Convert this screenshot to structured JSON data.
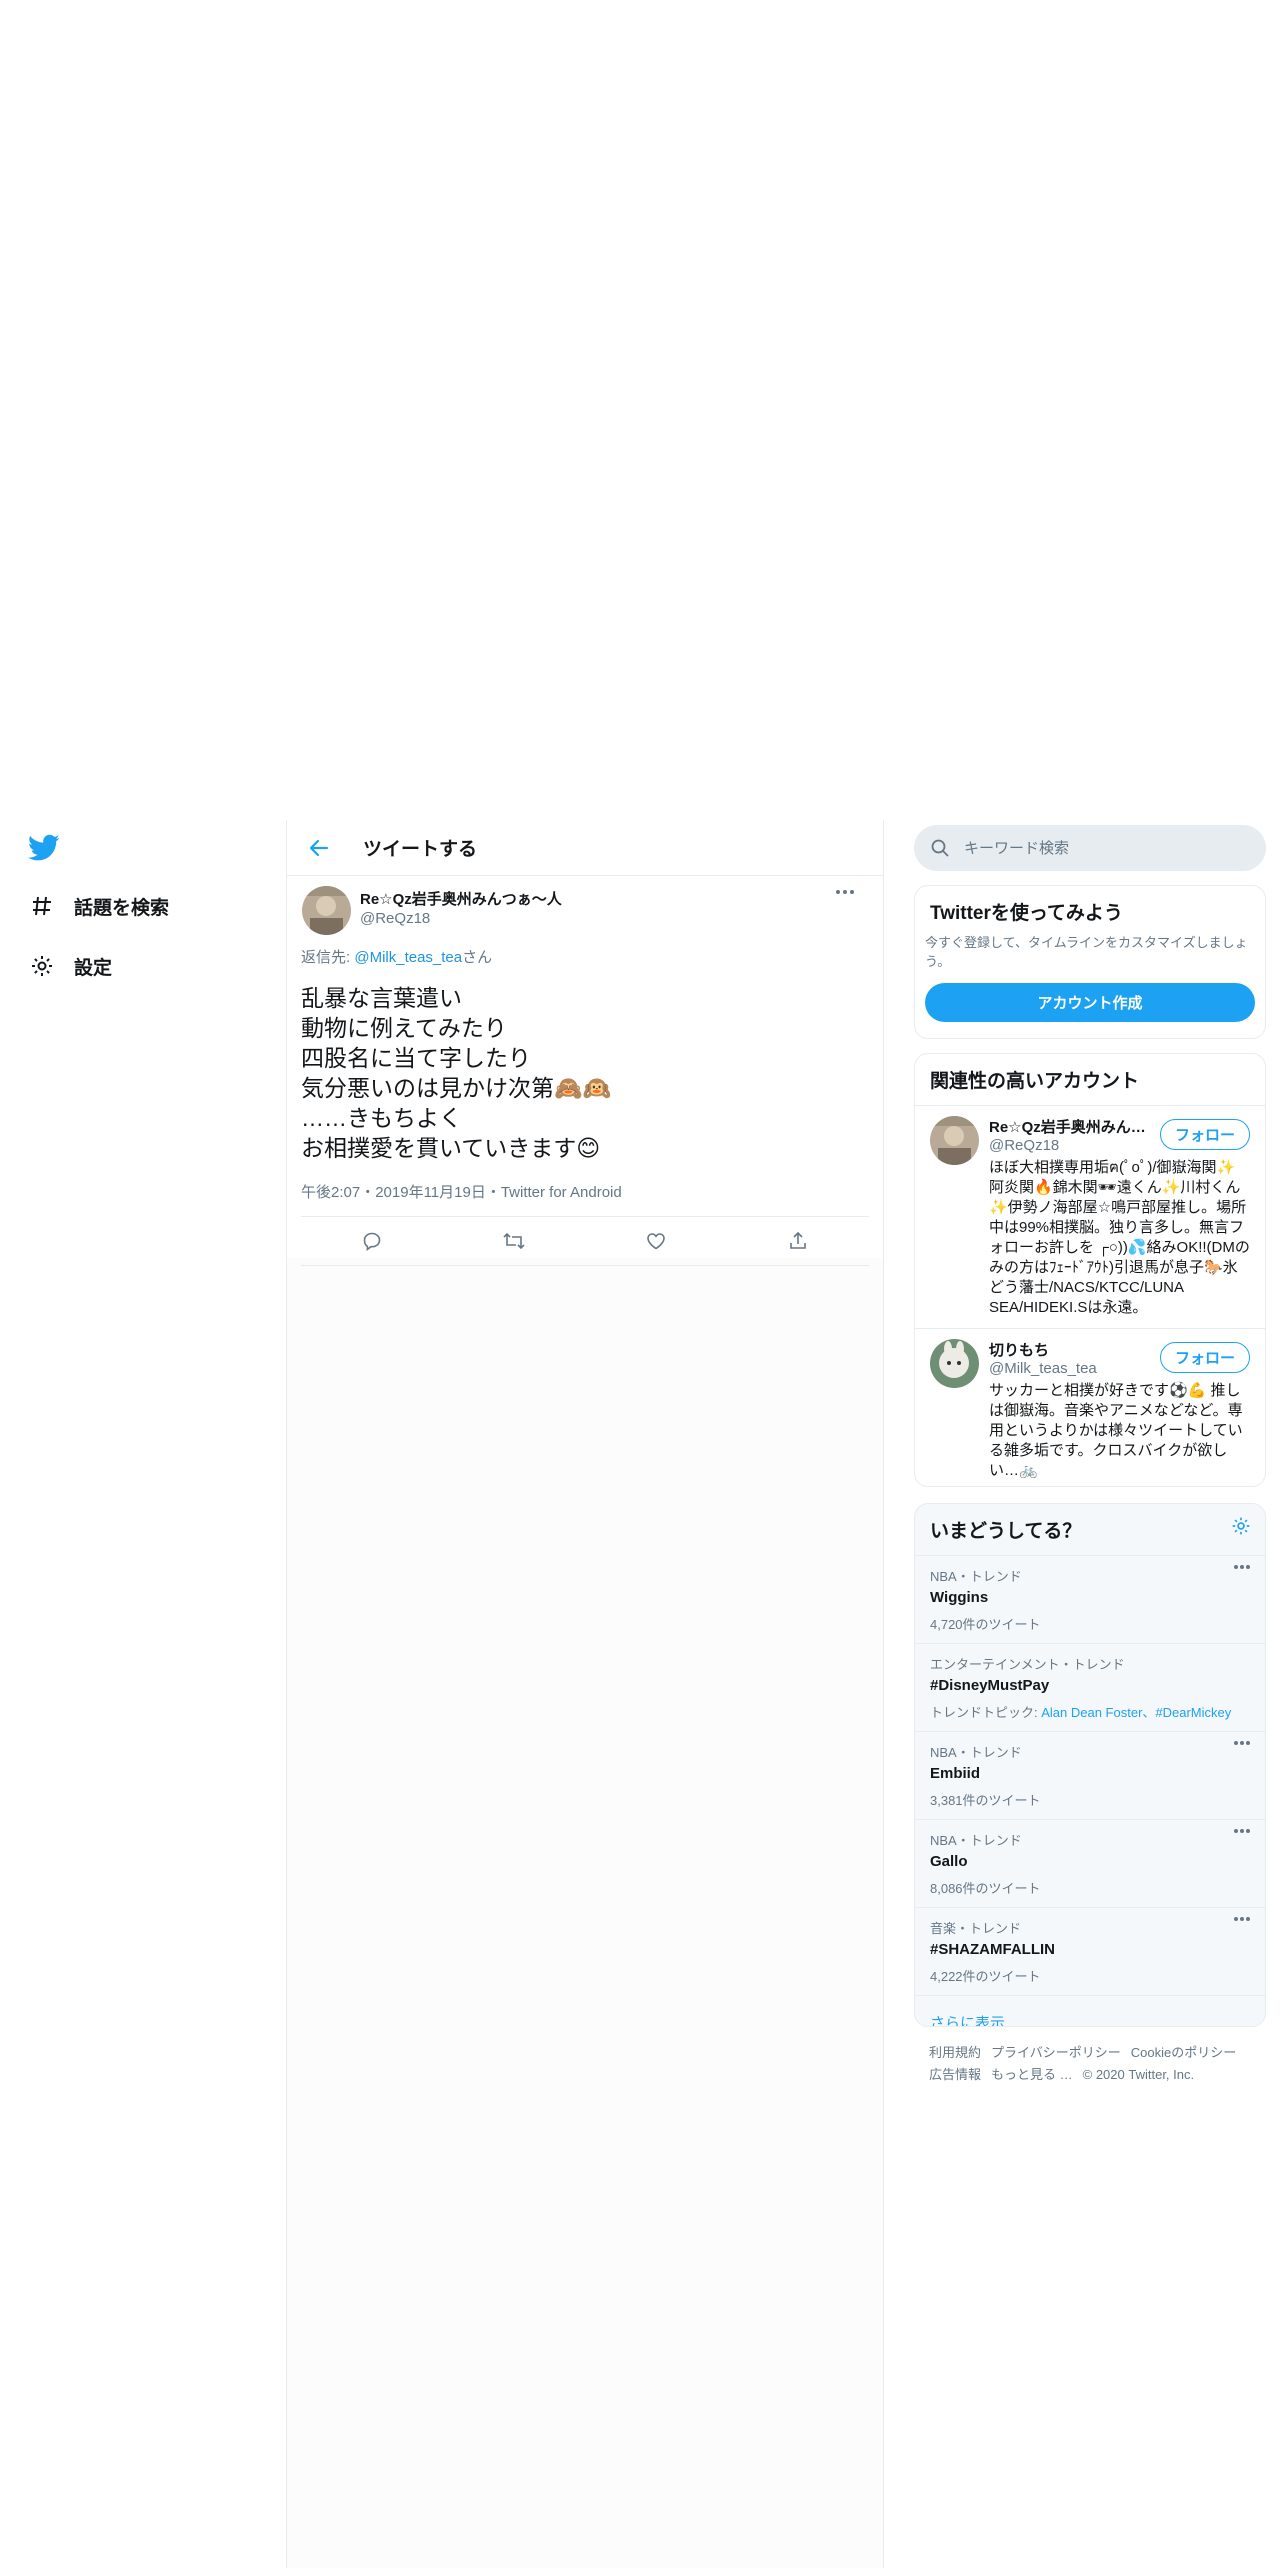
{
  "nav": {
    "logo": "twitter-bird",
    "explore": "話題を検索",
    "settings": "設定"
  },
  "header": {
    "title": "ツイートする"
  },
  "tweet": {
    "name": "Re☆Qz岩手奥州みんつぁ〜人",
    "handle": "@ReQz18",
    "reply_prefix": "返信先: ",
    "reply_handle": "@Milk_teas_tea",
    "reply_suffix": "さん",
    "text": "乱暴な言葉遣い\n動物に例えてみたり\n四股名に当て字したり\n気分悪いのは見かけ次第🙈🙉\n……きもちよく\nお相撲愛を貫いていきます😊",
    "meta": "午後2:07・2019年11月19日・Twitter for Android"
  },
  "search": {
    "placeholder": "キーワード検索"
  },
  "signup": {
    "title": "Twitterを使ってみよう",
    "subtitle": "今すぐ登録して、タイムラインをカスタマイズしましょう。",
    "button": "アカウント作成"
  },
  "related": {
    "title": "関連性の高いアカウント",
    "follow_label": "フォロー",
    "accounts": [
      {
        "name": "Re☆Qz岩手奥州みんつぁ〜人",
        "handle": "@ReQz18",
        "bio": "ほぼ大相撲専用垢ฅ(ﾟoﾟ)/御嶽海関✨阿炎関🔥錦木関🕶遠くん✨川村くん✨伊勢ノ海部屋☆鳴戸部屋推し。場所中は99%相撲脳。独り言多し。無言フォローお許しを ┌○))💦絡みOK!!(DMのみの方はﾌｪｰﾄﾞｱｳﾄ)引退馬が息子🐎氷どう藩士/NACS/KTCC/LUNA SEA/HIDEKI.Sは永遠。"
      },
      {
        "name": "切りもち",
        "handle": "@Milk_teas_tea",
        "bio": "サッカーと相撲が好きです⚽💪 推しは御嶽海。音楽やアニメなどなど。専用というよりかは様々ツイートしている雑多垢です。クロスバイクが欲しい…🚲"
      }
    ]
  },
  "trends": {
    "title": "いまどうしてる？",
    "items": [
      {
        "category": "NBA・トレンド",
        "name": "Wiggins",
        "count": "4,720件のツイート"
      },
      {
        "category": "エンターテインメント・トレンド",
        "name": "#DisneyMustPay",
        "topics_label": "トレンドトピック: ",
        "topics": "Alan Dean Foster、#DearMickey"
      },
      {
        "category": "NBA・トレンド",
        "name": "Embiid",
        "count": "3,381件のツイート"
      },
      {
        "category": "NBA・トレンド",
        "name": "Gallo",
        "count": "8,086件のツイート"
      },
      {
        "category": "音楽・トレンド",
        "name": "#SHAZAMFALLIN",
        "count": "4,222件のツイート"
      }
    ],
    "show_more": "さらに表示"
  },
  "footer": {
    "terms": "利用規約",
    "privacy": "プライバシーポリシー",
    "cookie": "Cookieのポリシー",
    "ads": "広告情報",
    "more": "もっと見る …",
    "copyright": "© 2020 Twitter, Inc."
  },
  "colors": {
    "accent": "#1da1f2",
    "text": "#14171a",
    "secondary": "#657786",
    "border": "#e6ecf0"
  }
}
